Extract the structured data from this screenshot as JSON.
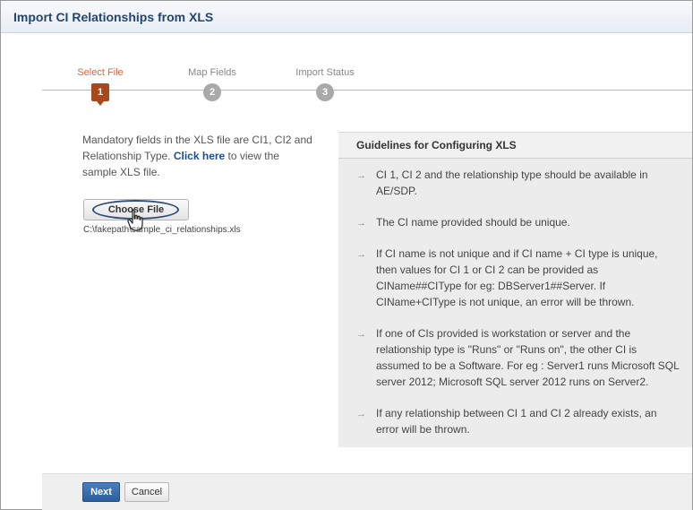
{
  "window": {
    "title": "Import CI Relationships from XLS"
  },
  "wizard": {
    "steps": [
      {
        "label": "Select File",
        "number": "1"
      },
      {
        "label": "Map Fields",
        "number": "2"
      },
      {
        "label": "Import Status",
        "number": "3"
      }
    ]
  },
  "intro": {
    "text_before": "Mandatory fields in the XLS file are CI1, CI2 and Relationship Type. ",
    "link": "Click here",
    "text_after": " to view the sample XLS file."
  },
  "file": {
    "choose_label": "Choose File",
    "path": "C:\\fakepath\\sample_ci_relationships.xls"
  },
  "guidelines": {
    "title": "Guidelines for Configuring XLS",
    "items": [
      "CI 1, CI 2 and the relationship type should be available in AE/SDP.",
      "The CI name provided should be unique.",
      "If CI name is not unique and if CI name + CI type is unique, then values for CI 1 or CI 2 can be provided as CIName##CIType for eg: DBServer1##Server. If CIName+CIType is not unique, an error will be thrown.",
      "If one of CIs provided is workstation or server and the relationship type is \"Runs\" or \"Runs on\", the other CI is assumed to be a Software. For eg : Server1 runs Microsoft SQL server 2012; Microsoft SQL server 2012 runs on Server2.",
      "If any relationship between CI 1 and CI 2 already exists, an error will be thrown."
    ]
  },
  "footer": {
    "next_label": "Next",
    "cancel_label": "Cancel"
  },
  "colors": {
    "title": "#24456f",
    "active_step": "#a8491d",
    "next_button": "#2c5f9e"
  }
}
